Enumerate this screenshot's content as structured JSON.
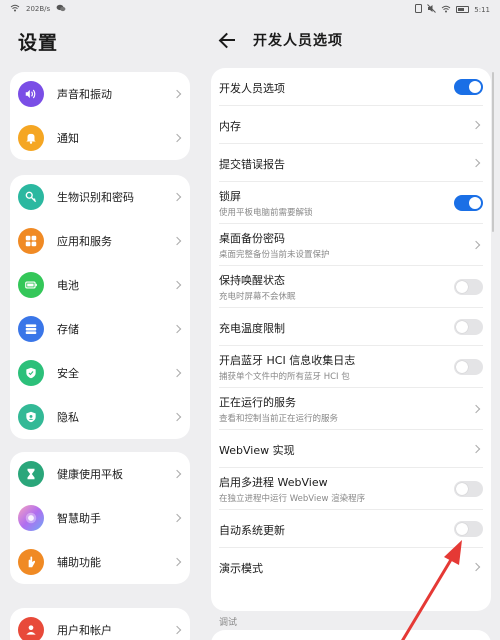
{
  "status_bar": {
    "speed": "202B/s",
    "time": "5:11"
  },
  "settings": {
    "title": "设置",
    "groups": [
      [
        {
          "label": "声音和振动",
          "icon": "speaker-icon",
          "color": "#7a4ee6"
        },
        {
          "label": "通知",
          "icon": "bell-icon",
          "color": "#f5a623"
        }
      ],
      [
        {
          "label": "生物识别和密码",
          "icon": "key-icon",
          "color": "#2bb8a0"
        },
        {
          "label": "应用和服务",
          "icon": "apps-grid-icon",
          "color": "#f08a24"
        },
        {
          "label": "电池",
          "icon": "battery-icon",
          "color": "#34c759"
        },
        {
          "label": "存储",
          "icon": "storage-icon",
          "color": "#3a76e8"
        },
        {
          "label": "安全",
          "icon": "shield-icon",
          "color": "#2cc07a"
        },
        {
          "label": "隐私",
          "icon": "privacy-icon",
          "color": "#33b996"
        }
      ],
      [
        {
          "label": "健康使用平板",
          "icon": "hourglass-icon",
          "color": "#2aa67a"
        },
        {
          "label": "智慧助手",
          "icon": "assistant-orb-icon",
          "color": "#c66ae0"
        },
        {
          "label": "辅助功能",
          "icon": "hand-icon",
          "color": "#f08a24"
        }
      ],
      [
        {
          "label": "用户和帐户",
          "icon": "user-icon",
          "color": "#e84a3a"
        }
      ]
    ]
  },
  "developer": {
    "title": "开发人员选项",
    "items": [
      {
        "label": "开发人员选项",
        "control": "toggle",
        "on": true
      },
      {
        "label": "内存",
        "control": "chevron"
      },
      {
        "label": "提交错误报告",
        "control": "chevron"
      },
      {
        "label": "锁屏",
        "sub": "使用平板电脑前需要解锁",
        "control": "toggle",
        "on": true
      },
      {
        "label": "桌面备份密码",
        "sub": "桌面完整备份当前未设置保护",
        "control": "chevron"
      },
      {
        "label": "保持唤醒状态",
        "sub": "充电时屏幕不会休眠",
        "control": "toggle",
        "on": false
      },
      {
        "label": "充电温度限制",
        "control": "toggle",
        "on": false
      },
      {
        "label": "开启蓝牙 HCI 信息收集日志",
        "sub": "捕获单个文件中的所有蓝牙 HCI 包",
        "control": "toggle",
        "on": false
      },
      {
        "label": "正在运行的服务",
        "sub": "查看和控制当前正在运行的服务",
        "control": "chevron"
      },
      {
        "label": "WebView 实现",
        "control": "chevron"
      },
      {
        "label": "启用多进程 WebView",
        "sub": "在独立进程中运行 WebView 渲染程序",
        "control": "toggle",
        "on": false
      },
      {
        "label": "自动系统更新",
        "control": "toggle",
        "on": false
      },
      {
        "label": "演示模式",
        "control": "chevron"
      }
    ],
    "section_debug": "调试"
  },
  "colors": {
    "accent": "#1a6fe6",
    "annotation_arrow": "#e53935"
  }
}
